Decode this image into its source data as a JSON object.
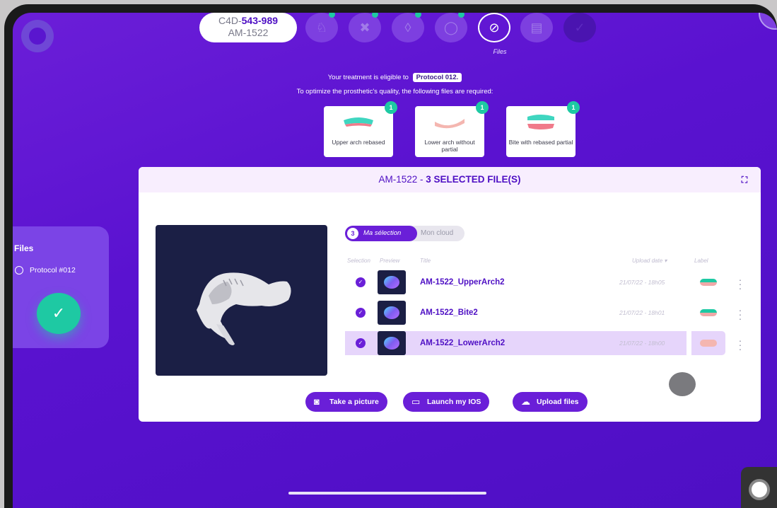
{
  "header": {
    "case_prefix": "C4D-",
    "case_number": "543-989",
    "patient_code": "AM-1522",
    "steps": [
      {
        "icon": "tooth-icon",
        "glyph": "♘"
      },
      {
        "icon": "cancel-circle-icon",
        "glyph": "✖"
      },
      {
        "icon": "drop-icon",
        "glyph": "💧"
      },
      {
        "icon": "chat-icon",
        "glyph": "◯"
      },
      {
        "icon": "paperclip-icon",
        "glyph": "∅"
      },
      {
        "icon": "calendar-icon",
        "glyph": "▤"
      },
      {
        "icon": "check-icon",
        "glyph": "✓"
      }
    ],
    "active_step_caption": "Files"
  },
  "protocol": {
    "eligible_text": "Your treatment is eligible to",
    "protocol_tag": "Protocol 012.",
    "required_text": "To optimize the prosthetic's quality, the following files are required:",
    "required_files": [
      {
        "label": "Upper arch rebased",
        "count": "1"
      },
      {
        "label": "Lower arch without partial",
        "count": "1"
      },
      {
        "label": "Bite with rebased partial",
        "count": "1"
      }
    ]
  },
  "sidebar": {
    "title": "Files",
    "option": "Protocol #012"
  },
  "modal": {
    "title_code": "AM-1522",
    "title_sep": " - ",
    "title_selected": "3 SELECTED FILE(S)",
    "tabs": {
      "active_count": "3",
      "active": "Ma sélection",
      "inactive": "Mon cloud"
    },
    "columns": {
      "selection": "Selection",
      "preview": "Preview",
      "title": "Title",
      "upload_date": "Upload date ▾",
      "label": "Label"
    },
    "files": [
      {
        "name": "AM-1522_UpperArch2",
        "date": "21/07/22 - 18h05"
      },
      {
        "name": "AM-1522_Bite2",
        "date": "21/07/22 - 18h01"
      },
      {
        "name": "AM-1522_LowerArch2",
        "date": "21/07/22 - 18h00"
      }
    ],
    "actions": {
      "picture": "Take a picture",
      "ios": "Launch my IOS",
      "upload": "Upload files"
    }
  },
  "colors": {
    "brand": "#4e0fc4",
    "accent": "#6a1fd8",
    "success": "#1ec9a3"
  }
}
